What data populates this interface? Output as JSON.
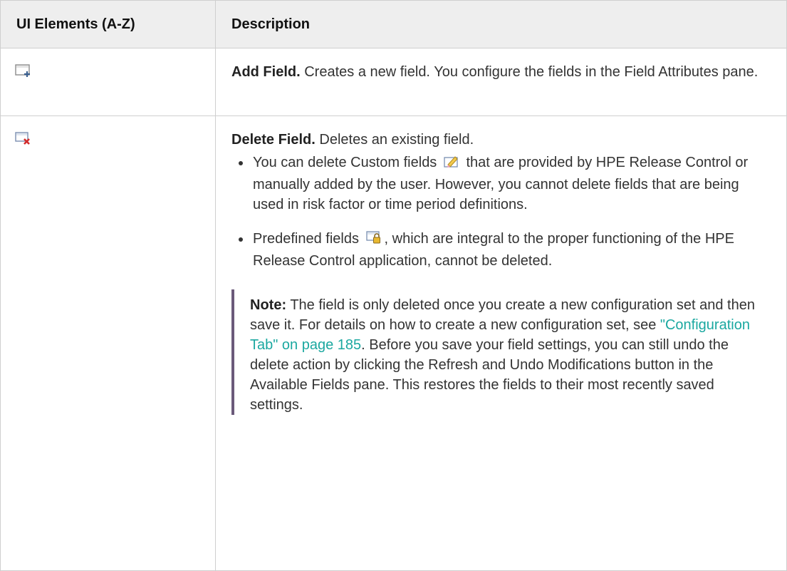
{
  "table": {
    "headers": {
      "col1": "UI Elements (A-Z)",
      "col2": "Description"
    },
    "rows": {
      "add_field": {
        "icon": "add-field-icon",
        "title": "Add Field.",
        "text": "Creates a new field. You configure the fields in the Field Attributes pane."
      },
      "delete_field": {
        "icon": "delete-field-icon",
        "title": "Delete Field.",
        "text": "Deletes an existing field.",
        "bullet1": {
          "before": "You can delete Custom fields",
          "icon": "custom-field-pencil-icon",
          "after": "that are provided by HPE Release Control or manually added by the user. However, you cannot delete fields that are being used in risk factor or time period definitions."
        },
        "bullet2": {
          "before": "Predefined fields",
          "icon": "predefined-field-lock-icon",
          "after": ", which are integral to the proper functioning of the HPE Release Control application, cannot be deleted."
        },
        "note": {
          "label": "Note:",
          "text1": "The field is only deleted once you create a new configuration set and then save it. For details on how to create a new configuration set, see",
          "link": "\"Configuration Tab\" on page 185",
          "text2": ". Before you save your field settings, you can still undo the delete action by clicking the Refresh and Undo Modifications button in the Available Fields pane. This restores the fields to their most recently saved settings."
        }
      }
    }
  },
  "colors": {
    "link": "#1ba8a0",
    "note_bar": "#6b5a7a",
    "header_bg": "#eeeeee",
    "border": "#cfcfcf"
  }
}
